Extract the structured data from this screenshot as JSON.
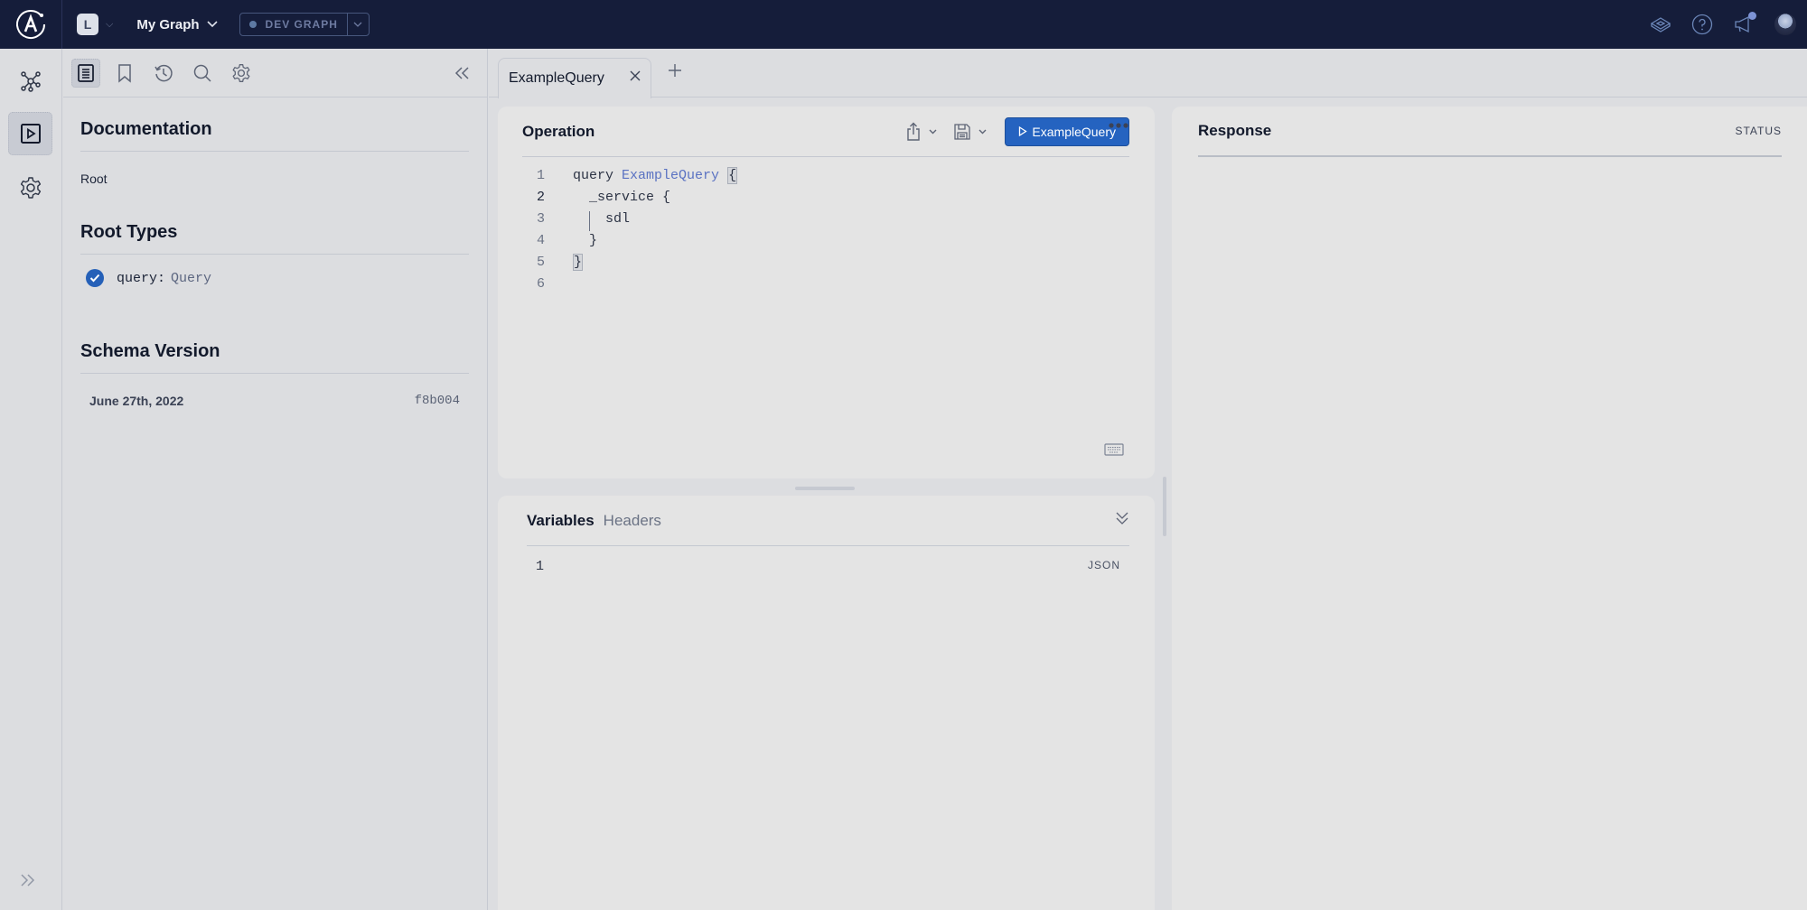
{
  "topbar": {
    "logo": "apollo-logo",
    "org_initial": "L",
    "graph_name": "My Graph",
    "variant": "DEV GRAPH",
    "colors": {
      "background": "#151d3a",
      "notification": "#7d93d6"
    },
    "icons": [
      "explorer-layers-icon",
      "help-icon",
      "announcements-icon",
      "user-avatar"
    ]
  },
  "leftnav": {
    "items": [
      {
        "name": "schema",
        "icon": "graph-nodes-icon",
        "active": false
      },
      {
        "name": "explorer",
        "icon": "play-square-icon",
        "active": true
      },
      {
        "name": "settings",
        "icon": "gear-icon",
        "active": false
      }
    ],
    "expand_icon": "double-chevron-right-icon"
  },
  "docs": {
    "toolbar": [
      {
        "name": "documentation",
        "icon": "document-icon",
        "active": true
      },
      {
        "name": "collections",
        "icon": "bookmark-icon",
        "active": false
      },
      {
        "name": "history",
        "icon": "history-icon",
        "active": false
      },
      {
        "name": "search",
        "icon": "search-icon",
        "active": false
      },
      {
        "name": "settings",
        "icon": "gear-icon",
        "active": false
      }
    ],
    "title": "Documentation",
    "breadcrumb": "Root",
    "root_types_title": "Root Types",
    "root_types": [
      {
        "key": "query:",
        "type": "Query",
        "checked": true
      }
    ],
    "schema_version_title": "Schema Version",
    "schema_version": {
      "date": "June 27th, 2022",
      "hash": "f8b004"
    }
  },
  "tabs": [
    {
      "label": "ExampleQuery",
      "active": true
    }
  ],
  "operation": {
    "title": "Operation",
    "run_label": "ExampleQuery",
    "accent": "#2563c0",
    "lines": [
      {
        "n": "1",
        "text": "query ExampleQuery {"
      },
      {
        "n": "2",
        "text": "  _service {"
      },
      {
        "n": "3",
        "text": "    sdl"
      },
      {
        "n": "4",
        "text": "  }"
      },
      {
        "n": "5",
        "text": "}"
      },
      {
        "n": "6",
        "text": ""
      }
    ],
    "tokens": {
      "keyword": "query",
      "name": "ExampleQuery",
      "field1": "_service",
      "field2": "sdl"
    }
  },
  "variables": {
    "tabs": [
      {
        "label": "Variables",
        "active": true
      },
      {
        "label": "Headers",
        "active": false
      }
    ],
    "line_number": "1",
    "format": "JSON"
  },
  "response": {
    "title": "Response",
    "status_label": "STATUS"
  }
}
